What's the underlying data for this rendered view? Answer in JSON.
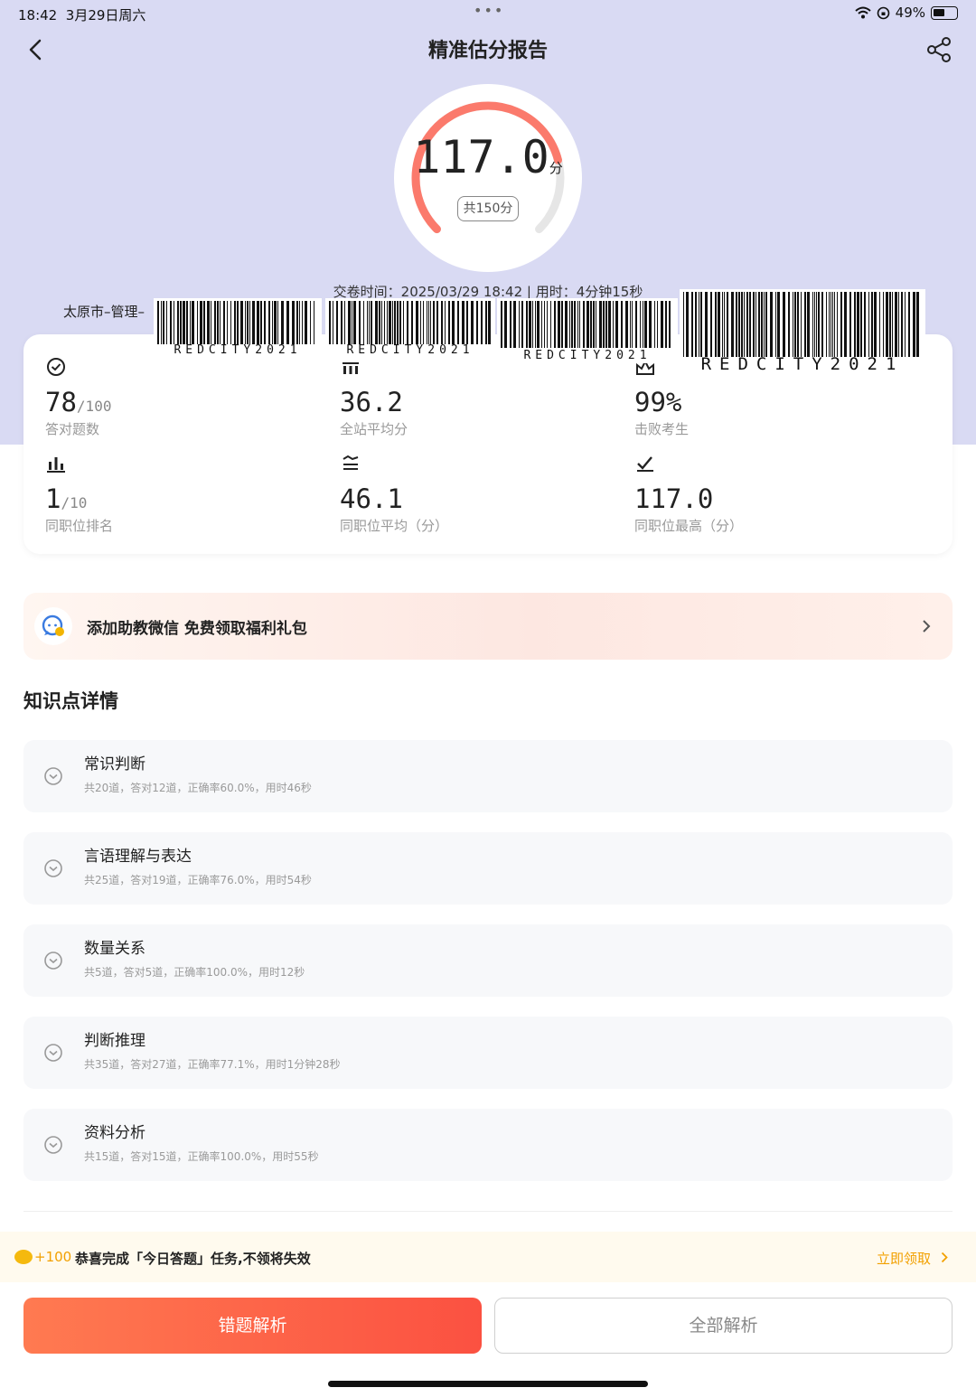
{
  "status_bar": {
    "time": "18:42",
    "date": "3月29日周六",
    "battery": "49%",
    "battery_level": 0.49
  },
  "header": {
    "title": "精准估分报告"
  },
  "score": {
    "value": "117.0",
    "unit": "分",
    "total": "共150分",
    "fraction": 0.78
  },
  "submit_info": "交卷时间：2025/03/29 18:42 | 用时：4分钟15秒",
  "location": "太原市–管理–",
  "watermark": {
    "text": "REDCITY2021"
  },
  "stats": [
    {
      "value": "78",
      "suffix": "/100",
      "label": "答对题数",
      "icon": "check-circle-icon"
    },
    {
      "value": "36.2",
      "suffix": "",
      "label": "全站平均分",
      "icon": "average-icon"
    },
    {
      "value": "99%",
      "suffix": "",
      "label": "击败考生",
      "icon": "beat-icon"
    },
    {
      "value": "1",
      "suffix": "/10",
      "label": "同职位排名",
      "icon": "rank-icon"
    },
    {
      "value": "46.1",
      "suffix": "",
      "label": "同职位平均（分）",
      "icon": "position-average-icon"
    },
    {
      "value": "117.0",
      "suffix": "",
      "label": "同职位最高（分）",
      "icon": "position-max-icon"
    }
  ],
  "promo": {
    "text": "添加助教微信 免费领取福利礼包"
  },
  "knowledge_title": "知识点详情",
  "knowledge_points": [
    {
      "name": "常识判断",
      "detail": "共20道，答对12道，正确率60.0%，用时46秒"
    },
    {
      "name": "言语理解与表达",
      "detail": "共25道，答对19道，正确率76.0%，用时54秒"
    },
    {
      "name": "数量关系",
      "detail": "共5道，答对5道，正确率100.0%，用时12秒"
    },
    {
      "name": "判断推理",
      "detail": "共35道，答对27道，正确率77.1%，用时1分钟28秒"
    },
    {
      "name": "资料分析",
      "detail": "共15道，答对15道，正确率100.0%，用时55秒"
    }
  ],
  "task": {
    "reward": "+100",
    "text": "恭喜完成「今日答题」任务,不领将失效",
    "action": "立即领取"
  },
  "buttons": {
    "wrong_analysis": "错题解析",
    "all_analysis": "全部解析"
  },
  "colors": {
    "hero_bg": "#d9daf3",
    "gauge_arc": "#fb7a6c",
    "accent_orange": "#f2a000",
    "primary_button": "#fb5b45"
  }
}
